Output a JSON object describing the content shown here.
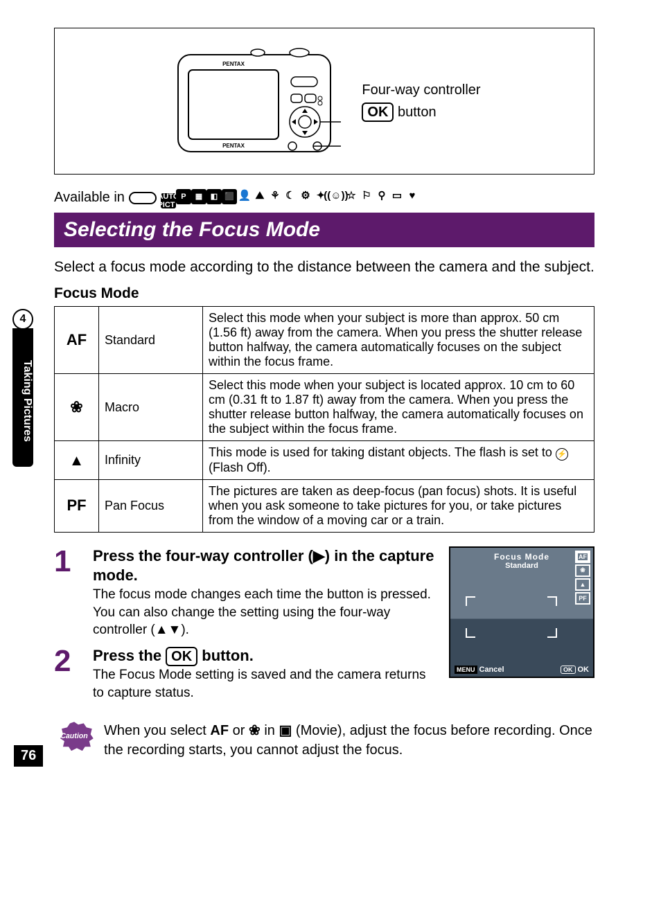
{
  "side": {
    "chapter_num": "4",
    "chapter_label": "Taking Pictures"
  },
  "camera": {
    "brand": "PENTAX",
    "callout_controller": "Four-way controller",
    "callout_ok_prefix": "OK",
    "callout_ok_suffix": " button"
  },
  "available": {
    "prefix": "Available in",
    "modes": [
      "AUTO PICT",
      "P",
      "▦",
      "◧",
      "⬛",
      "👤",
      "⛰",
      "⚘",
      "☾",
      "⚙",
      "✦",
      "((☺))",
      "☆",
      "⚐",
      "⚲",
      "▭",
      "♥"
    ]
  },
  "section_title": "Selecting the Focus Mode",
  "intro": "Select a focus mode according to the distance between the camera and the subject.",
  "subhead": "Focus Mode",
  "table": [
    {
      "icon": "AF",
      "name": "Standard",
      "desc": "Select this mode when your subject is more than approx. 50 cm (1.56 ft) away from the camera. When you press the shutter release button halfway, the camera automatically focuses on the subject within the focus frame."
    },
    {
      "icon": "❀",
      "name": "Macro",
      "desc": "Select this mode when your subject is located approx. 10 cm to 60 cm (0.31 ft to 1.87 ft) away from the camera. When you press the shutter release button halfway, the camera automatically focuses on the subject within the focus frame."
    },
    {
      "icon": "▲",
      "name": "Infinity",
      "desc_pre": "This mode is used for taking distant objects. The flash is set to ",
      "flash_icon": "⚡",
      "desc_post": " (Flash Off)."
    },
    {
      "icon": "PF",
      "name": "Pan Focus",
      "desc": "The pictures are taken as deep-focus (pan focus) shots. It is useful when you ask someone to take pictures for you, or take pictures from the window of a moving car or a train."
    }
  ],
  "steps": [
    {
      "num": "1",
      "title": "Press the four-way controller (▶) in the capture mode.",
      "text": "The focus mode changes each time the button is pressed. You can also change the setting using the four-way controller (▲▼)."
    },
    {
      "num": "2",
      "title_pre": "Press the ",
      "title_btn": "OK",
      "title_post": " button.",
      "text": "The Focus Mode setting is saved and the camera returns to capture status."
    }
  ],
  "lcd": {
    "title": "Focus Mode",
    "subtitle": "Standard",
    "icons": [
      "AF",
      "❀",
      "▲",
      "PF"
    ],
    "menu_label": "MENU",
    "cancel": "Cancel",
    "ok_box": "OK",
    "ok_label": "OK"
  },
  "caution": {
    "badge": "Caution",
    "pre": "When you select ",
    "af": "AF",
    "mid1": " or ",
    "macro_icon": "❀",
    "mid2": " in ",
    "movie_icon": "▣",
    "mid3": " (Movie), adjust the focus before recording. Once the recording starts, you cannot adjust the focus."
  },
  "page_number": "76"
}
